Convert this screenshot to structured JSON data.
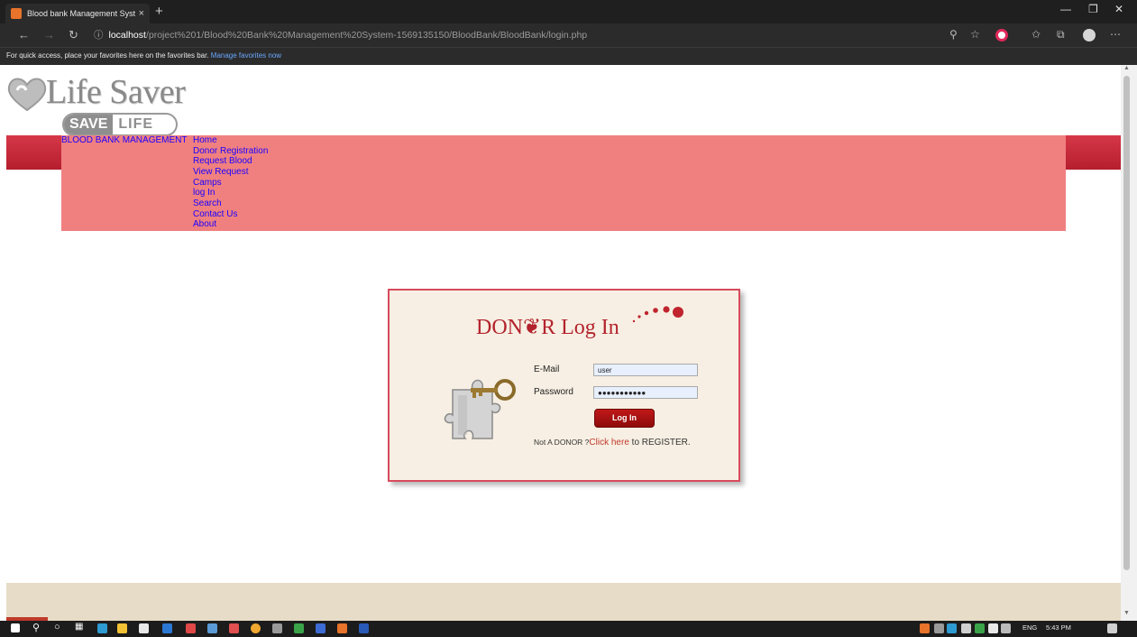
{
  "browser": {
    "tab_title": "Blood bank Management Syster",
    "new_tab_symbol": "+",
    "close_symbol": "×",
    "url_host": "localhost",
    "url_path": "/project%201/Blood%20Bank%20Management%20System-1569135150/BloodBank/BloodBank/login.php",
    "favorites_message": "For quick access, place your favorites here on the favorites bar.",
    "favorites_link": "Manage favorites now"
  },
  "logo": {
    "title": "Life Saver",
    "badge_save": "SAVE",
    "badge_life": "LIFE"
  },
  "nav": {
    "brand": "BLOOD BANK MANAGEMENT",
    "items": [
      {
        "label": "Home"
      },
      {
        "label": "Donor Registration"
      },
      {
        "label": "Request Blood"
      },
      {
        "label": "View Request"
      },
      {
        "label": "Camps"
      },
      {
        "label": "log In"
      },
      {
        "label": "Search"
      },
      {
        "label": "Contact Us"
      },
      {
        "label": "About"
      }
    ]
  },
  "login": {
    "title": "DON❦R Log In",
    "email_label": "E-Mail",
    "email_value": "user",
    "password_label": "Password",
    "password_value": "●●●●●●●●●●●",
    "button_label": "Log In",
    "register_prefix": "Not A DONOR ?",
    "register_link": "Click here",
    "register_suffix": " to REGISTER."
  },
  "taskbar": {
    "language": "ENG",
    "time": "5:43 PM"
  },
  "colors": {
    "nav_background": "#f08080",
    "nav_link": "#1a00ff",
    "accent_red": "#b3232d",
    "card_background": "#f7efe3",
    "footer_background": "#e7dcc7"
  }
}
